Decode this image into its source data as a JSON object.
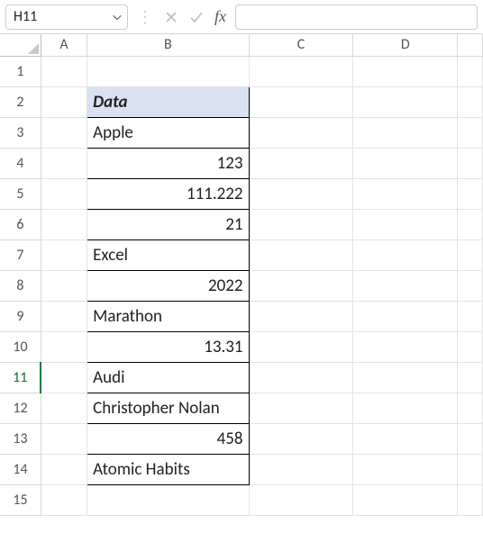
{
  "formula_bar": {
    "name_box": "H11",
    "fx_label": "fx",
    "formula": ""
  },
  "columns": [
    "A",
    "B",
    "C",
    "D"
  ],
  "rows": [
    "1",
    "2",
    "3",
    "4",
    "5",
    "6",
    "7",
    "8",
    "9",
    "10",
    "11",
    "12",
    "13",
    "14",
    "15"
  ],
  "active_row": "11",
  "table": {
    "header": "Data",
    "cells": [
      {
        "value": "Apple",
        "align": "left"
      },
      {
        "value": "123",
        "align": "right"
      },
      {
        "value": "111.222",
        "align": "right"
      },
      {
        "value": "21",
        "align": "right"
      },
      {
        "value": "Excel",
        "align": "left"
      },
      {
        "value": "2022",
        "align": "right"
      },
      {
        "value": "Marathon",
        "align": "left"
      },
      {
        "value": "13.31",
        "align": "right"
      },
      {
        "value": "Audi",
        "align": "left"
      },
      {
        "value": "Christopher Nolan",
        "align": "left"
      },
      {
        "value": "458",
        "align": "right"
      },
      {
        "value": "Atomic Habits",
        "align": "left"
      }
    ]
  },
  "chart_data": {
    "type": "table",
    "title": "Data",
    "values": [
      "Apple",
      123,
      111.222,
      21,
      "Excel",
      2022,
      "Marathon",
      13.31,
      "Audi",
      "Christopher Nolan",
      458,
      "Atomic Habits"
    ]
  }
}
